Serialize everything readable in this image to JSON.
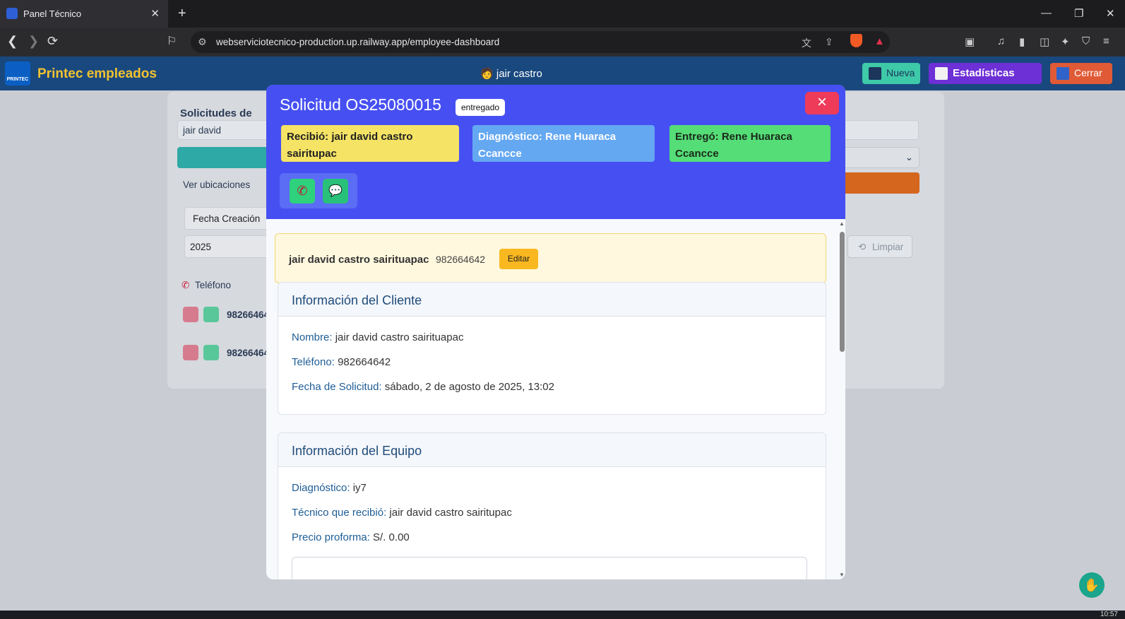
{
  "browser": {
    "tab_title": "Panel Técnico",
    "url": "webserviciotecnico-production.up.railway.app/employee-dashboard"
  },
  "app": {
    "brand": "Printec empleados",
    "logo_text": "PRINTEC",
    "user": "jair castro",
    "buttons": {
      "nueva": "Nueva",
      "estadisticas": "Estadísticas",
      "cerrar": "Cerrar"
    }
  },
  "background": {
    "list_title": "Solicitudes de",
    "search_value": "jair david",
    "ver_ubicaciones": "Ver ubicaciones",
    "sort_select": "Fecha Creación",
    "year_select": "2025",
    "limpiar": "Limpiar",
    "phone_header": "Teléfono",
    "row_phone_1": "98266464",
    "row_phone_2": "98266464"
  },
  "modal": {
    "title": "Solicitud OS25080015",
    "status_badge": "entregado",
    "close_symbol": "×",
    "chips": {
      "recibio_label": "Recibió:",
      "recibio_value": "jair david castro sairitupac",
      "diagnostico_label": "Diagnóstico:",
      "diagnostico_value": "Rene Huaraca Ccancce",
      "entrego_label": "Entregó:",
      "entrego_value": "Rene Huaraca Ccancce"
    },
    "client_banner": {
      "name": "jair david castro sairituapac",
      "phone": "982664642",
      "edit_label": "Editar"
    },
    "client_section": {
      "title": "Información del Cliente",
      "nombre_label": "Nombre:",
      "nombre_value": "jair david castro sairituapac",
      "telefono_label": "Teléfono:",
      "telefono_value": "982664642",
      "fecha_label": "Fecha de Solicitud:",
      "fecha_value": "sábado, 2 de agosto de 2025, 13:02"
    },
    "equipment_section": {
      "title": "Información del Equipo",
      "diagnostico_label": "Diagnóstico:",
      "diagnostico_value": "iy7",
      "tecnico_label": "Técnico que recibió:",
      "tecnico_value": "jair david castro sairitupac",
      "precio_label": "Precio proforma:",
      "precio_value": "S/. 0.00"
    }
  },
  "taskbar": {
    "clock": "10:57"
  }
}
